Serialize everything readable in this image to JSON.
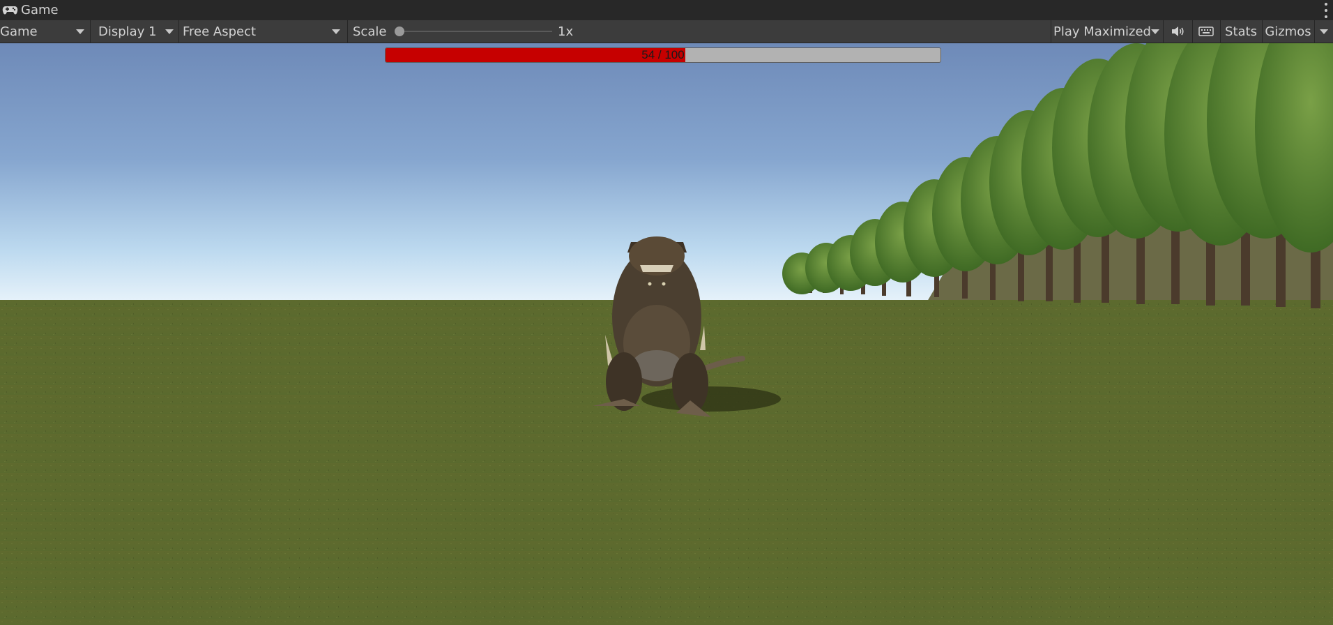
{
  "tab": {
    "icon": "gamepad-icon",
    "title": "Game"
  },
  "toolbar": {
    "view_mode": "Game",
    "display": "Display 1",
    "aspect": "Free Aspect",
    "scale_label": "Scale",
    "scale_value": "1x",
    "scale_fraction": 0.0,
    "play_mode": "Play Maximized",
    "mute_icon": "speaker-icon",
    "keyboard_icon": "keyboard-icon",
    "stats_label": "Stats",
    "gizmos_label": "Gizmos"
  },
  "hud": {
    "health_current": 54,
    "health_max": 100,
    "health_text": "54 / 100",
    "health_fill_color": "#c60000",
    "health_track_color": "#b2b2b2"
  },
  "scene": {
    "sky_top_color": "#6e8ab8",
    "sky_horizon_color": "#e6f2fa",
    "ground_color": "#5e6a2f",
    "foliage_color": "#5b8a32"
  }
}
